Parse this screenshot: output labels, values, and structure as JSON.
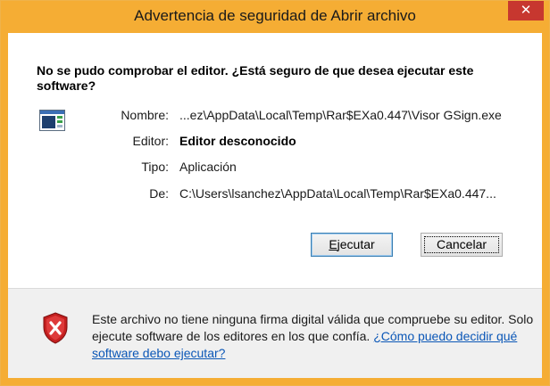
{
  "window": {
    "title": "Advertencia de seguridad de Abrir archivo",
    "close_glyph": "✕",
    "accent": "#f5ad34"
  },
  "dialog": {
    "heading": "No se pudo comprobar el editor. ¿Está seguro de que desea ejecutar este software?",
    "file_icon": "executable-window-icon",
    "fields": [
      {
        "label": "Nombre:",
        "value": "...ez\\AppData\\Local\\Temp\\Rar$EXa0.447\\Visor GSign.exe"
      },
      {
        "label": "Editor:",
        "value": "Editor desconocido"
      },
      {
        "label": "Tipo:",
        "value": "Aplicación"
      },
      {
        "label": "De:",
        "value": "C:\\Users\\lsanchez\\AppData\\Local\\Temp\\Rar$EXa0.447..."
      }
    ],
    "run_button": {
      "mnemonic": "E",
      "rest": "jecutar"
    },
    "cancel_button": "Cancelar"
  },
  "warning": {
    "icon": "shield-error-icon",
    "text": "Este archivo no tiene ninguna firma digital válida que compruebe su editor. Solo ejecute software de los editores en los que confía.",
    "link": "¿Cómo puedo decidir qué software debo ejecutar?"
  }
}
